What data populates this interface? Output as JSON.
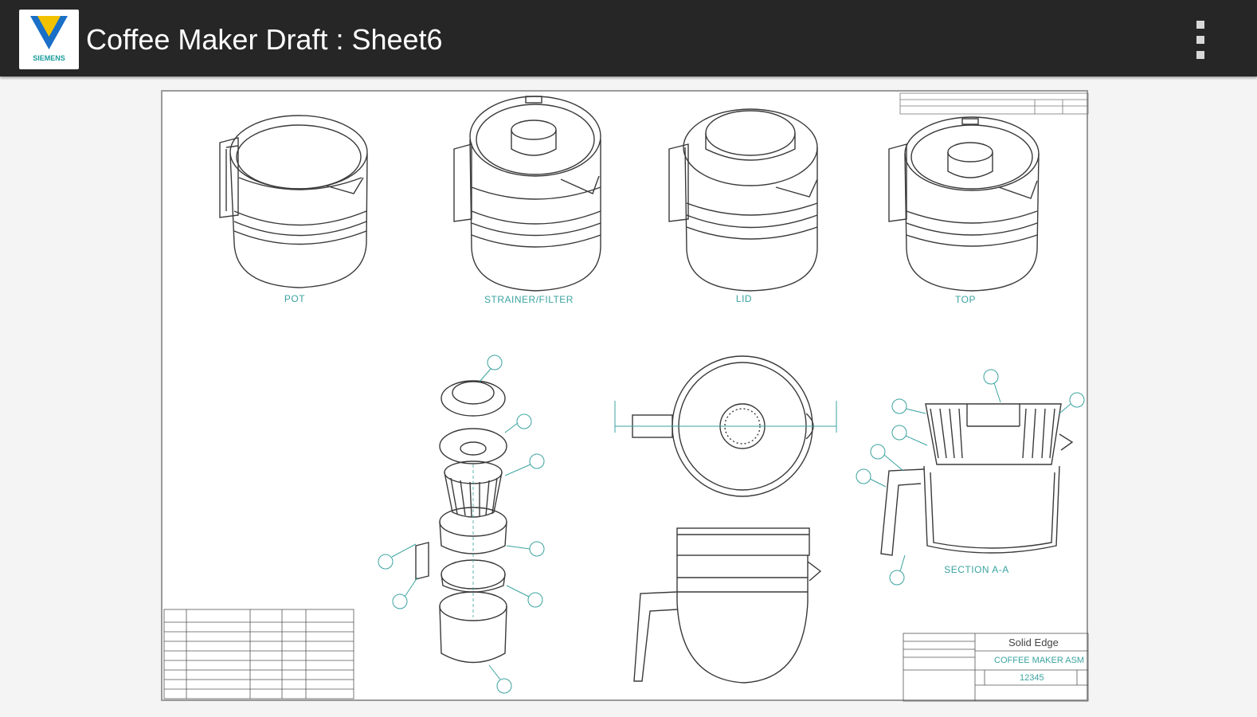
{
  "app": {
    "title": "Coffee Maker Draft : Sheet6",
    "logo_text": "SIEMENS",
    "menu_icon": "overflow-menu-icon"
  },
  "drawing": {
    "views": {
      "pot": "POT",
      "strainer_filter": "STRAINER/FILTER",
      "lid": "LID",
      "top": "TOP",
      "section": "SECTION A-A"
    },
    "title_block": {
      "company": "Solid Edge",
      "drawing_title": "COFFEE MAKER ASM",
      "drawing_number": "12345"
    }
  },
  "colors": {
    "topbar": "#262626",
    "sheet_bg": "#ffffff",
    "line": "#3a3a3a",
    "annotation": "#3aa3a0",
    "logo_blue": "#1a6fc7",
    "logo_yellow": "#f2c200"
  }
}
